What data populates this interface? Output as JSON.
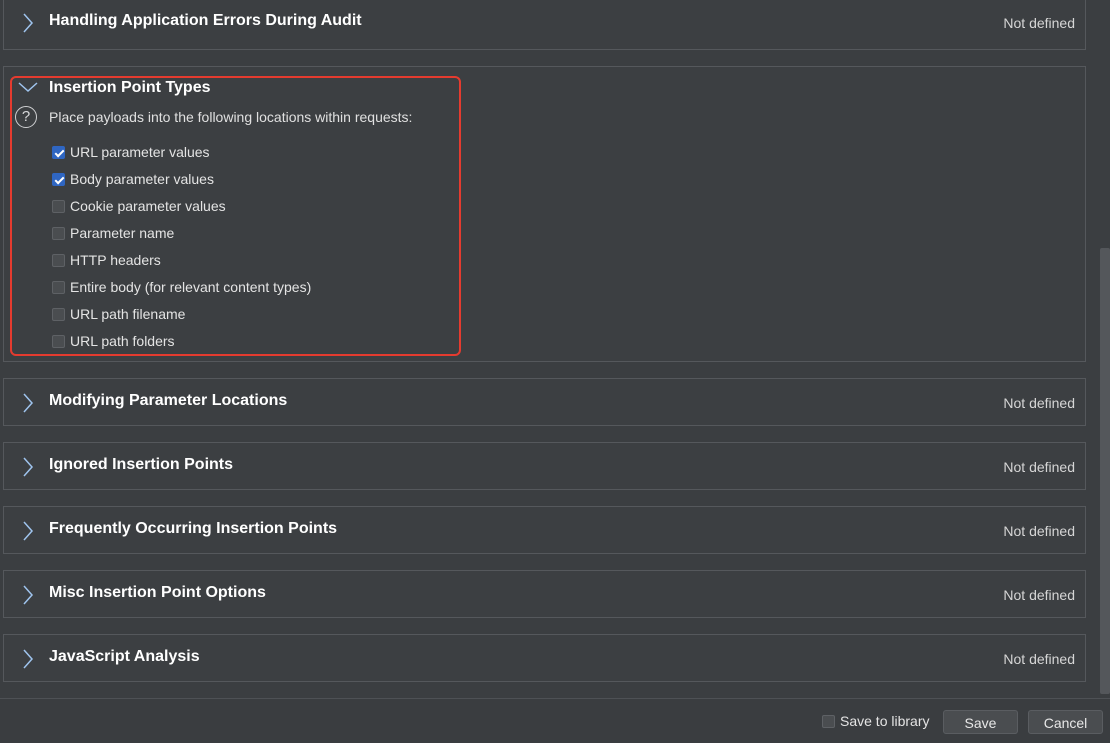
{
  "sections_top": {
    "label": "Handling Application Errors During Audit",
    "status": "Not defined"
  },
  "insertion_point_types": {
    "title": "Insertion Point Types",
    "help_glyph": "?",
    "description": "Place payloads into the following locations within requests:",
    "options": [
      {
        "label": "URL parameter values",
        "checked": true
      },
      {
        "label": "Body parameter values",
        "checked": true
      },
      {
        "label": "Cookie parameter values",
        "checked": false
      },
      {
        "label": "Parameter name",
        "checked": false
      },
      {
        "label": "HTTP headers",
        "checked": false
      },
      {
        "label": "Entire body (for relevant content types)",
        "checked": false
      },
      {
        "label": "URL path filename",
        "checked": false
      },
      {
        "label": "URL path folders",
        "checked": false
      }
    ]
  },
  "sections": [
    {
      "label": "Modifying Parameter Locations",
      "status": "Not defined"
    },
    {
      "label": "Ignored Insertion Points",
      "status": "Not defined"
    },
    {
      "label": "Frequently Occurring Insertion Points",
      "status": "Not defined"
    },
    {
      "label": "Misc Insertion Point Options",
      "status": "Not defined"
    },
    {
      "label": "JavaScript Analysis",
      "status": "Not defined"
    }
  ],
  "footer": {
    "save_to_library_label": "Save to library",
    "save_to_library_checked": false,
    "save_label": "Save",
    "cancel_label": "Cancel"
  },
  "colors": {
    "background": "#3b3e41",
    "checkbox_checked": "#2f66c2",
    "highlight_border": "#e53b2f"
  }
}
